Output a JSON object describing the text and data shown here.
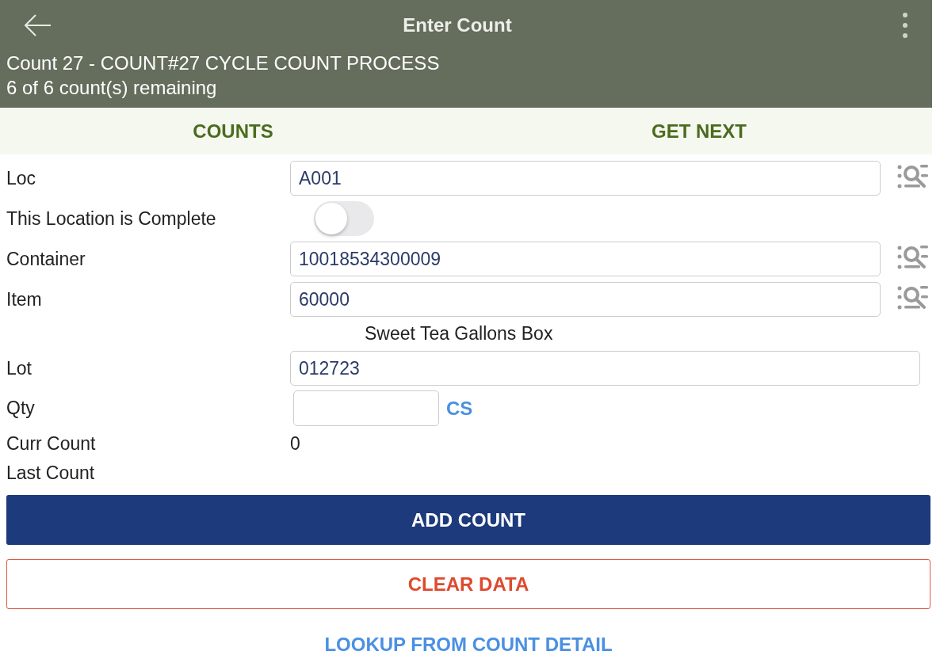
{
  "header": {
    "title": "Enter Count",
    "subtitle_lines": [
      "Count 27 - COUNT#27 CYCLE COUNT PROCESS",
      "6 of 6 count(s) remaining"
    ]
  },
  "tabs": [
    {
      "label": "COUNTS"
    },
    {
      "label": "GET NEXT"
    }
  ],
  "form": [
    {
      "kind": "input",
      "label": "Loc",
      "value": "A001",
      "lookup": true
    },
    {
      "kind": "toggle",
      "label": "This Location is Complete",
      "on": false
    },
    {
      "kind": "input",
      "label": "Container",
      "value": "10018534300009",
      "lookup": true
    },
    {
      "kind": "input",
      "label": "Item",
      "value": "60000",
      "lookup": true
    },
    {
      "kind": "caption",
      "text": "Sweet Tea Gallons Box"
    },
    {
      "kind": "input",
      "label": "Lot",
      "value": "012723",
      "lookup": false
    },
    {
      "kind": "qty",
      "label": "Qty",
      "unit": "CS"
    },
    {
      "kind": "value",
      "label": "Curr Count",
      "value": "0"
    },
    {
      "kind": "value",
      "label": "Last Count"
    }
  ],
  "buttons": [
    {
      "kind": "primary",
      "label": "ADD COUNT"
    },
    {
      "kind": "outline",
      "label": "CLEAR DATA"
    },
    {
      "kind": "link",
      "label": "LOOKUP FROM COUNT DETAIL"
    }
  ]
}
